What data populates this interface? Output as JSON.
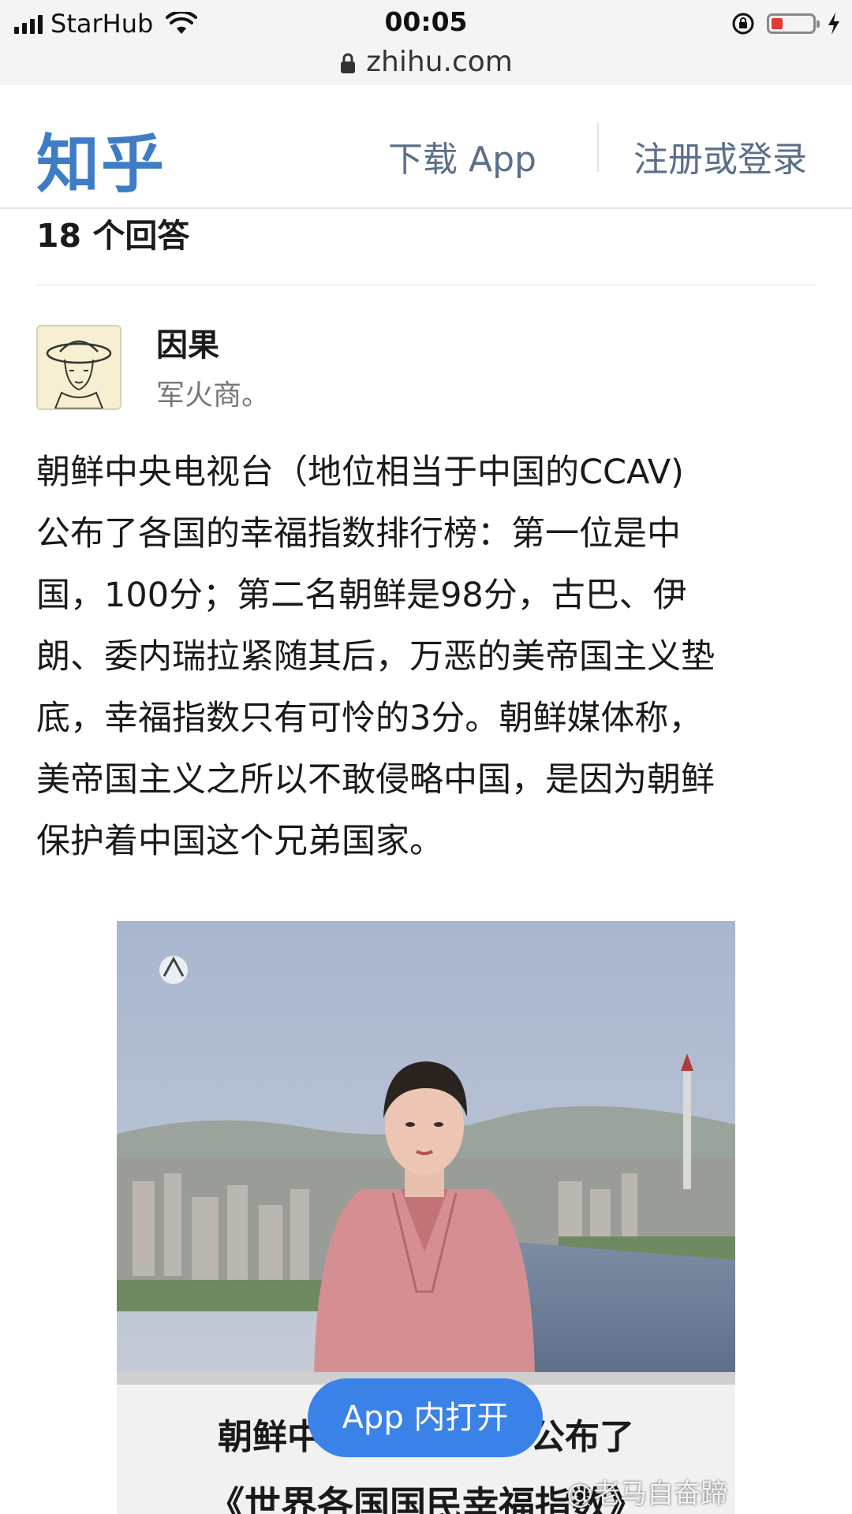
{
  "status_bar": {
    "carrier": "StarHub",
    "time": "00:05",
    "url": "zhihu.com"
  },
  "header": {
    "logo": "知乎",
    "download_app": "下载 App",
    "login": "注册或登录"
  },
  "answers_count": "18 个回答",
  "answer": {
    "author": "因果",
    "bio": "军火商。",
    "body_lines": [
      "朝鲜中央电视台（地位相当于中国的CCAV)",
      "公布了各国的幸福指数排行榜：第一位是中",
      "国，100分；第二名朝鲜是98分，古巴、伊",
      "朗、委内瑞拉紧随其后，万恶的美帝国主义垫",
      "底，幸福指数只有可怜的3分。朝鲜媒体称，",
      "美帝国主义之所以不敢侵略中国，是因为朝鲜",
      "保护着中国这个兄弟国家。"
    ]
  },
  "figure": {
    "caption_line1": "朝鲜中　　　　　　公布了",
    "caption_line2": "《世界各国国民幸福指数》"
  },
  "open_in_app": "App 内打开",
  "watermark": "@老马自奋蹄"
}
